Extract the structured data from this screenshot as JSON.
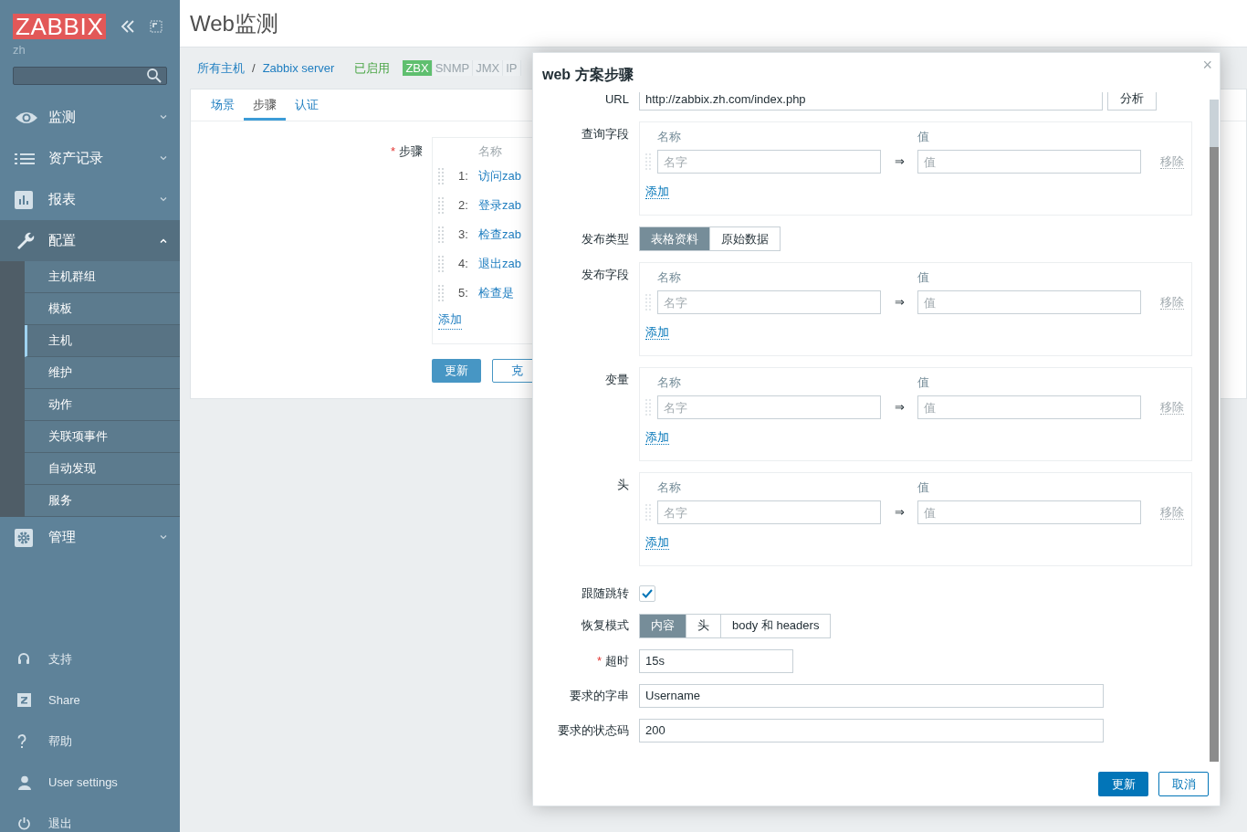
{
  "sidebar": {
    "logo": "ZABBIX",
    "user": "zh",
    "menu": [
      {
        "label": "监测",
        "expanded": false
      },
      {
        "label": "资产记录",
        "expanded": false
      },
      {
        "label": "报表",
        "expanded": false
      },
      {
        "label": "配置",
        "expanded": true,
        "children": [
          {
            "label": "主机群组",
            "selected": false
          },
          {
            "label": "模板",
            "selected": false
          },
          {
            "label": "主机",
            "selected": true
          },
          {
            "label": "维护",
            "selected": false
          },
          {
            "label": "动作",
            "selected": false
          },
          {
            "label": "关联项事件",
            "selected": false
          },
          {
            "label": "自动发现",
            "selected": false
          },
          {
            "label": "服务",
            "selected": false
          }
        ]
      },
      {
        "label": "管理",
        "expanded": false
      }
    ],
    "bottom": [
      "支持",
      "Share",
      "帮助",
      "User settings",
      "退出"
    ]
  },
  "header": {
    "title": "Web监测"
  },
  "breadcrumb": {
    "items": [
      "所有主机",
      "Zabbix server"
    ],
    "separator": "/",
    "status": "已启用",
    "tags": [
      {
        "label": "ZBX",
        "on": true
      },
      {
        "label": "SNMP",
        "on": false
      },
      {
        "label": "JMX",
        "on": false
      },
      {
        "label": "IP",
        "on": false
      }
    ]
  },
  "tabs": [
    {
      "label": "场景",
      "selected": false
    },
    {
      "label": "步骤",
      "selected": true
    },
    {
      "label": "认证",
      "selected": false
    }
  ],
  "steps": {
    "label": "步骤",
    "required_mark": "*",
    "column": "名称",
    "rows": [
      {
        "number": "1:",
        "name": "访问zab"
      },
      {
        "number": "2:",
        "name": "登录zab"
      },
      {
        "number": "3:",
        "name": "检查zab"
      },
      {
        "number": "4:",
        "name": "退出zab"
      },
      {
        "number": "5:",
        "name": "检查是"
      }
    ],
    "add": "添加",
    "buttons": [
      "更新",
      "克"
    ]
  },
  "dialog": {
    "title": "web 方案步骤",
    "close": "×",
    "fields": [
      {
        "kind": "url",
        "label": "URL",
        "value": "http://zabbix.zh.com/index.php",
        "button": "分析"
      },
      {
        "kind": "pairs",
        "label": "查询字段",
        "name_header": "名称",
        "value_header": "值",
        "name_placeholder": "名字",
        "arrow": "⇒",
        "value_placeholder": "值",
        "remove": "移除",
        "add": "添加"
      },
      {
        "kind": "segmented",
        "label": "发布类型",
        "options": [
          {
            "label": "表格资料",
            "selected": true
          },
          {
            "label": "原始数据",
            "selected": false
          }
        ]
      },
      {
        "kind": "pairs",
        "label": "发布字段",
        "name_header": "名称",
        "value_header": "值",
        "name_placeholder": "名字",
        "arrow": "⇒",
        "value_placeholder": "值",
        "remove": "移除",
        "add": "添加"
      },
      {
        "kind": "pairs",
        "label": "变量",
        "name_header": "名称",
        "value_header": "值",
        "name_placeholder": "名字",
        "arrow": "⇒",
        "value_placeholder": "值",
        "remove": "移除",
        "add": "添加"
      },
      {
        "kind": "pairs",
        "label": "头",
        "name_header": "名称",
        "value_header": "值",
        "name_placeholder": "名字",
        "arrow": "⇒",
        "value_placeholder": "值",
        "remove": "移除",
        "add": "添加"
      },
      {
        "kind": "checkbox",
        "label": "跟随跳转",
        "checked": true
      },
      {
        "kind": "segmented",
        "label": "恢复模式",
        "options": [
          {
            "label": "内容",
            "selected": true
          },
          {
            "label": "头",
            "selected": false
          },
          {
            "label": "body 和 headers",
            "selected": false
          }
        ]
      },
      {
        "kind": "short",
        "label": "超时",
        "required_mark": "*",
        "value": "15s"
      },
      {
        "kind": "input",
        "label": "要求的字串",
        "value": "Username"
      },
      {
        "kind": "input",
        "label": "要求的状态码",
        "value": "200"
      }
    ],
    "buttons": [
      {
        "label": "更新",
        "primary": true
      },
      {
        "label": "取消",
        "primary": false
      }
    ]
  }
}
